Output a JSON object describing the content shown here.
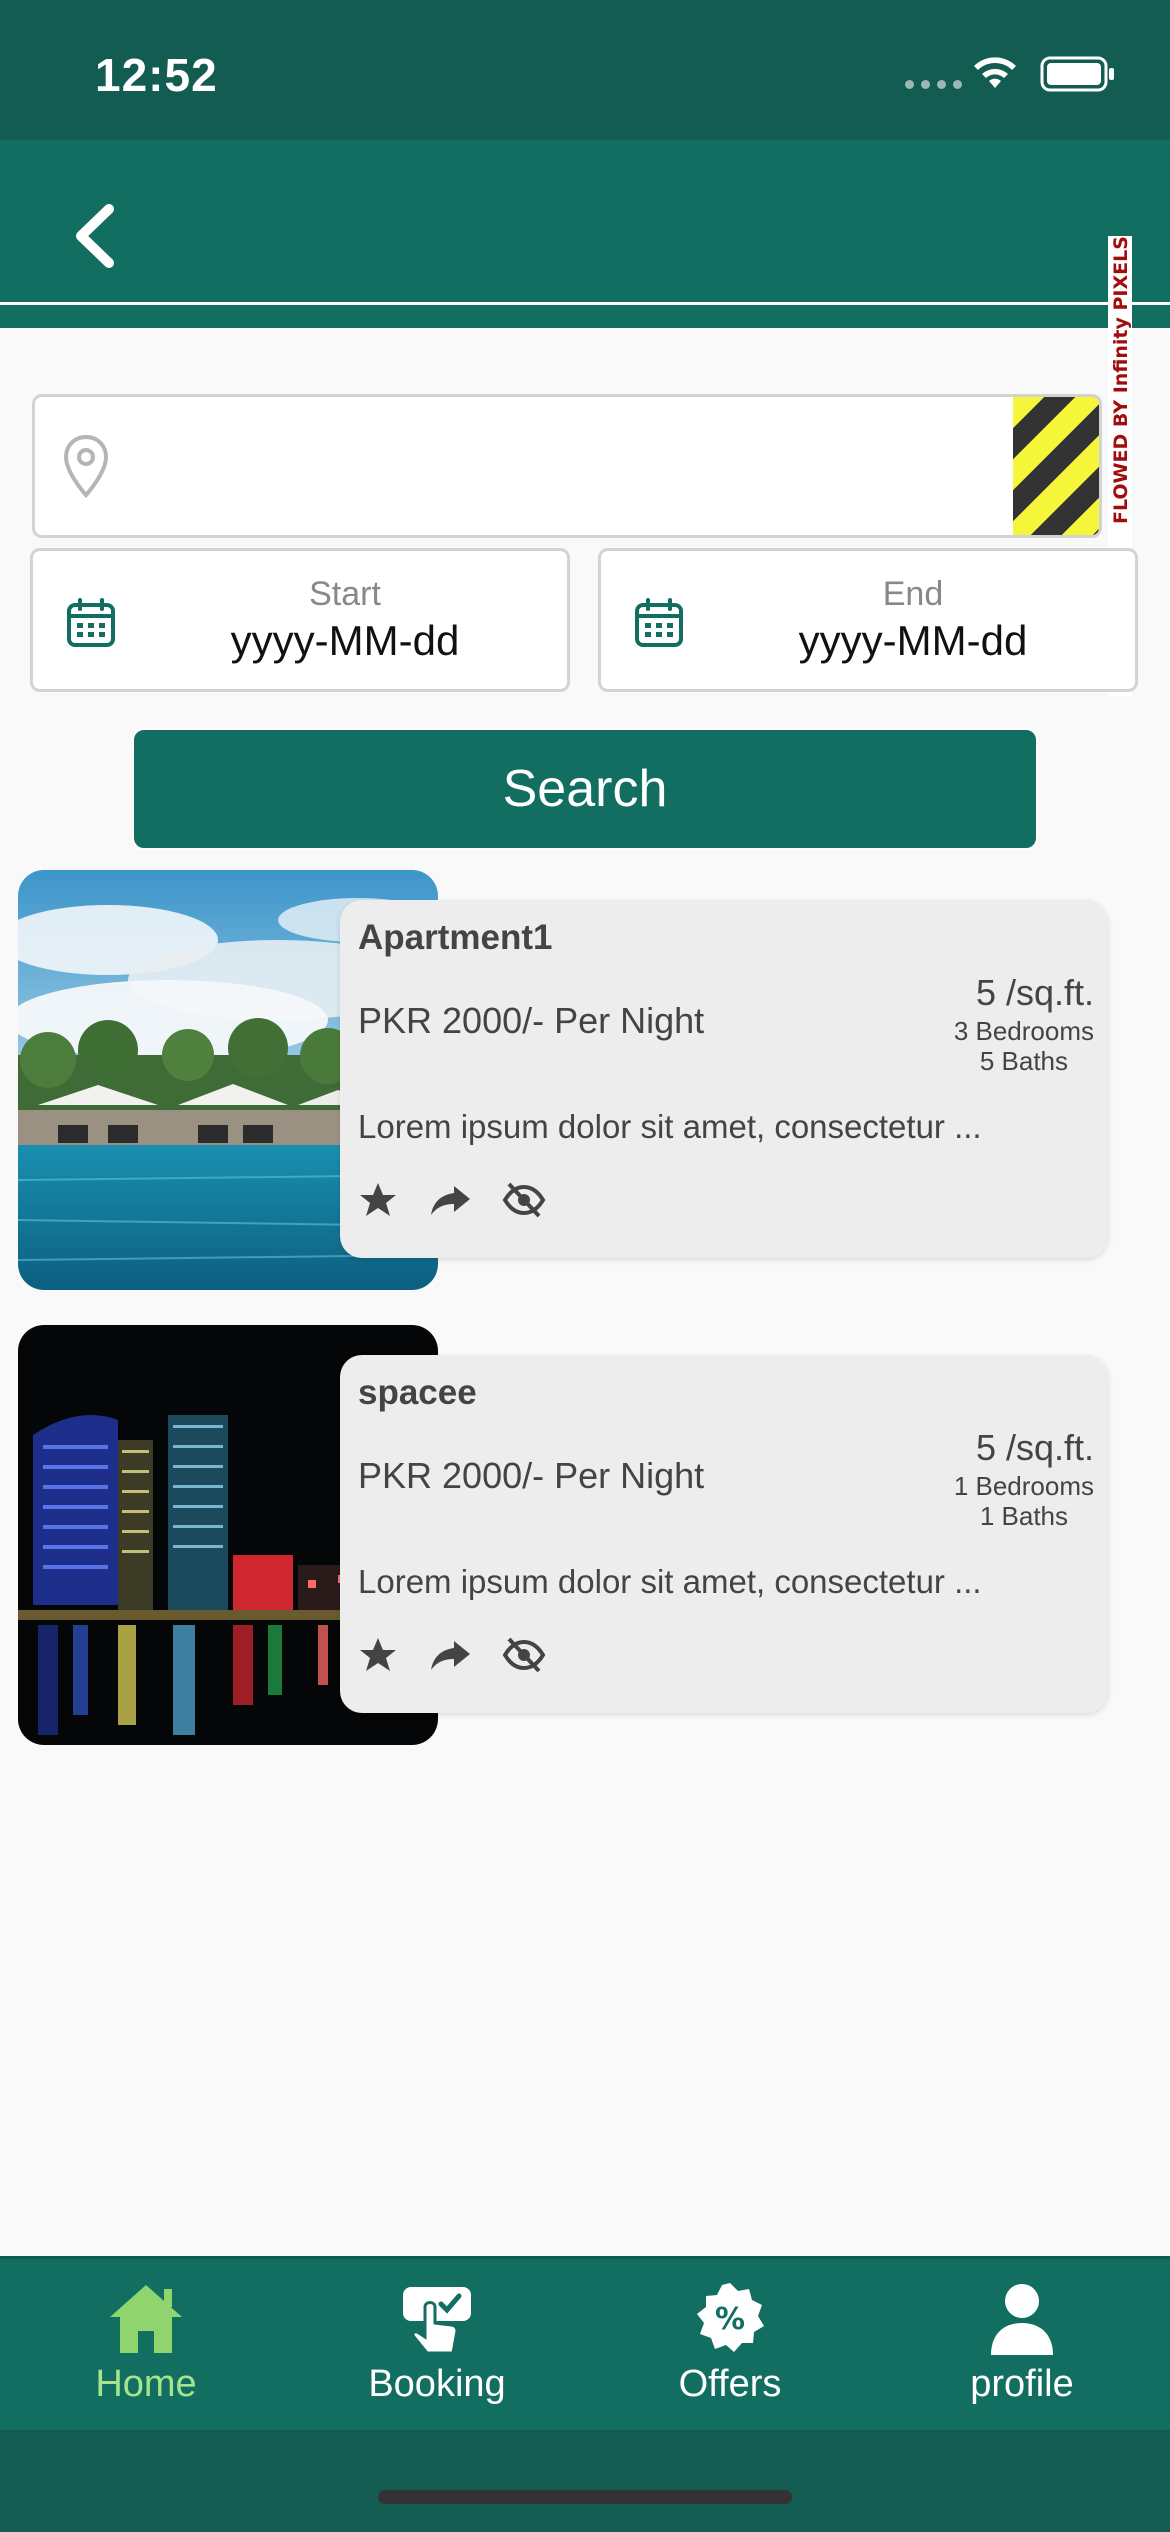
{
  "status_bar": {
    "time": "12:52"
  },
  "banner": {
    "text": "FLOWED BY Infinity PIXELS"
  },
  "search": {
    "location_placeholder": "",
    "start_label": "Start",
    "start_value": "yyyy-MM-dd",
    "end_label": "End",
    "end_value": "yyyy-MM-dd",
    "button_label": "Search"
  },
  "listings": [
    {
      "title": "Apartment1",
      "price": "PKR 2000/- Per Night",
      "area": "5 /sq.ft.",
      "bedrooms": "3 Bedrooms",
      "baths": "5 Baths",
      "description": "Lorem ipsum dolor sit amet, consectetur ...",
      "image": "pool-resort-photo"
    },
    {
      "title": "spacee",
      "price": "PKR 2000/- Per Night",
      "area": "5 /sq.ft.",
      "bedrooms": "1 Bedrooms",
      "baths": "1 Baths",
      "description": "Lorem ipsum dolor sit amet, consectetur ...",
      "image": "city-night-photo"
    }
  ],
  "bottom_nav": {
    "items": [
      {
        "label": "Home",
        "icon": "home-icon",
        "active": true
      },
      {
        "label": "Booking",
        "icon": "booking-icon",
        "active": false
      },
      {
        "label": "Offers",
        "icon": "offers-icon",
        "active": false
      },
      {
        "label": "profile",
        "icon": "profile-icon",
        "active": false
      }
    ]
  },
  "colors": {
    "primary": "#136e62",
    "status_bar": "#125c52",
    "active_nav": "#a3e48d"
  }
}
